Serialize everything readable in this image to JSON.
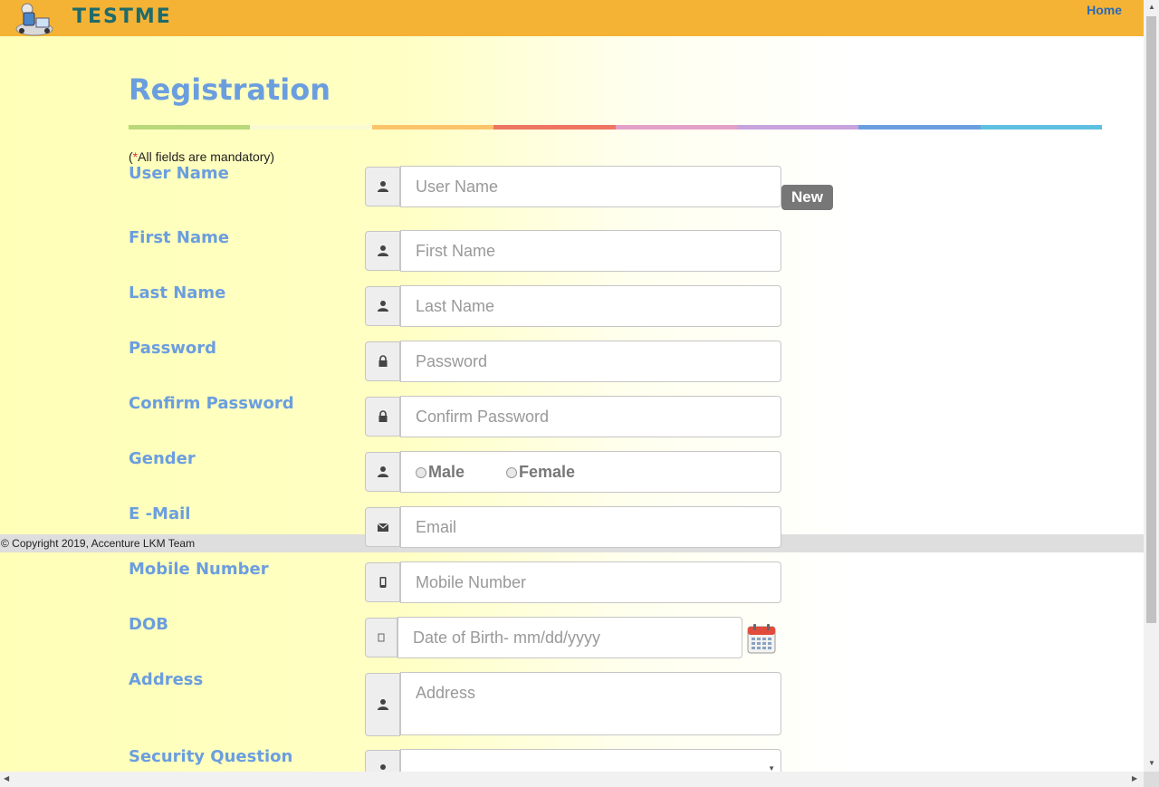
{
  "header": {
    "logo_text": "TESTME",
    "home_link": "Home"
  },
  "page": {
    "title": "Registration",
    "mandatory_prefix": "(",
    "mandatory_star": "*",
    "mandatory_text": "All fields are mandatory)",
    "color_stripes": [
      "#b8d87a",
      "#fafad2",
      "#fcc46a",
      "#ee7560",
      "#e3a0c8",
      "#c8a3de",
      "#6b9edf",
      "#5ec0e0"
    ]
  },
  "form": {
    "username": {
      "label": "User Name",
      "placeholder": "User Name",
      "badge": "New"
    },
    "firstname": {
      "label": "First Name",
      "placeholder": "First Name"
    },
    "lastname": {
      "label": "Last Name",
      "placeholder": "Last Name"
    },
    "password": {
      "label": "Password",
      "placeholder": "Password"
    },
    "confirm_password": {
      "label": "Confirm Password",
      "placeholder": "Confirm Password"
    },
    "gender": {
      "label": "Gender",
      "option_male": "Male",
      "option_female": "Female"
    },
    "email": {
      "label": "E -Mail",
      "placeholder": "Email"
    },
    "mobile": {
      "label": "Mobile Number",
      "placeholder": "Mobile Number"
    },
    "dob": {
      "label": "DOB",
      "placeholder": "Date of Birth- mm/dd/yyyy"
    },
    "address": {
      "label": "Address",
      "placeholder": "Address"
    },
    "security_question": {
      "label": "Security Question",
      "selected": ""
    }
  },
  "footer": {
    "copyright": "© Copyright 2019, Accenture LKM Team"
  },
  "icons": {
    "user": "user-icon",
    "lock": "lock-icon",
    "envelope": "envelope-icon",
    "mobile": "mobile-icon",
    "calendar": "calendar-icon"
  }
}
